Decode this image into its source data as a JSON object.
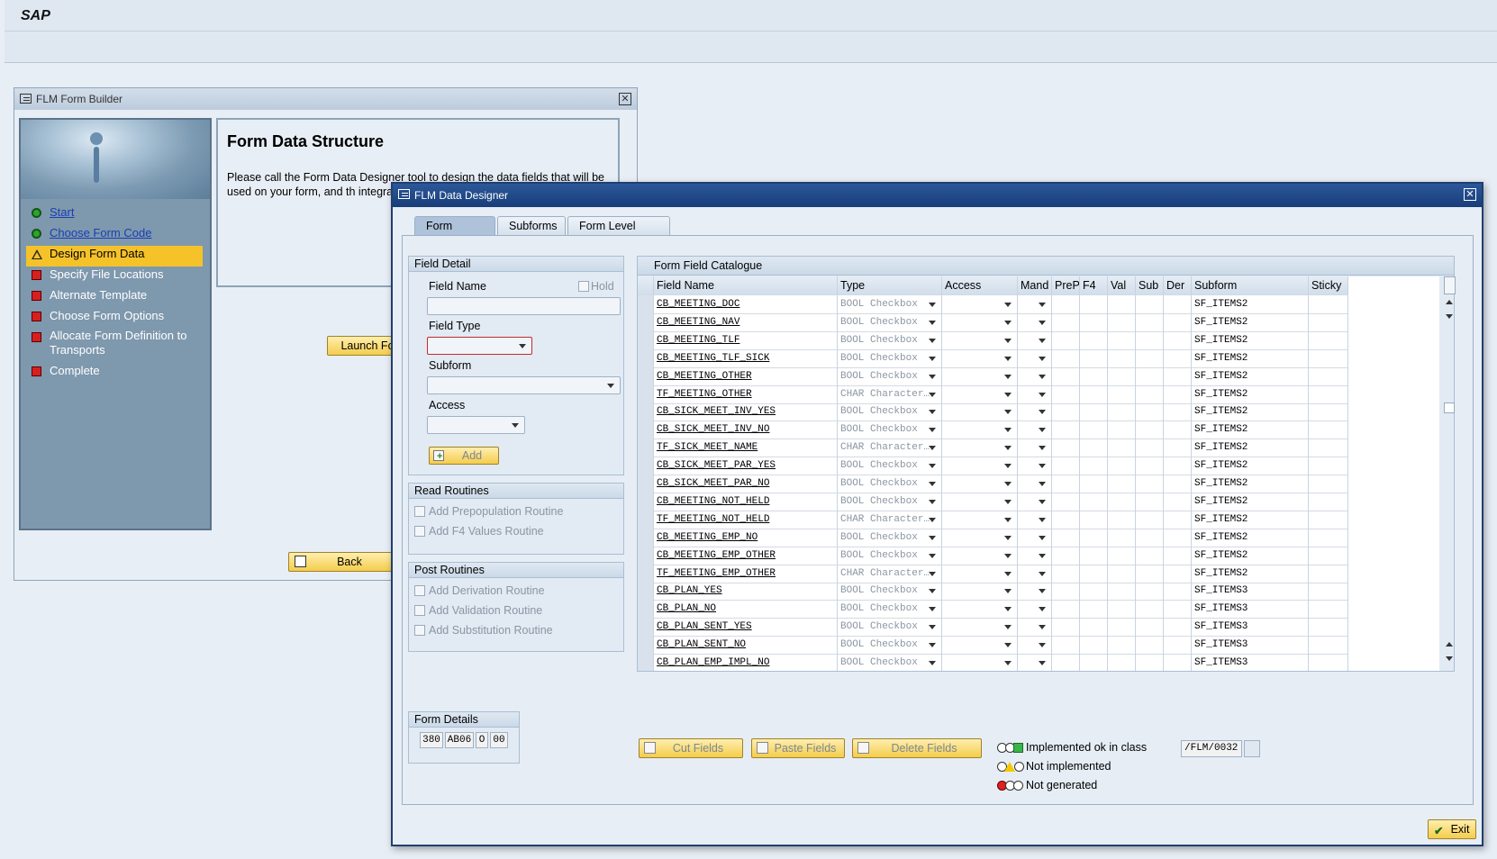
{
  "app": {
    "brand": "SAP"
  },
  "builder": {
    "title": "FLM Form Builder",
    "steps": [
      {
        "label": "Start",
        "status": "green",
        "link": true
      },
      {
        "label": "Choose Form Code",
        "status": "green",
        "link": true
      },
      {
        "label": "Design Form Data",
        "status": "warning",
        "active": true
      },
      {
        "label": "Specify File Locations",
        "status": "red"
      },
      {
        "label": "Alternate Template",
        "status": "red"
      },
      {
        "label": "Choose Form Options",
        "status": "red"
      },
      {
        "label": "Allocate Form Definition to Transports",
        "status": "red"
      },
      {
        "label": "Complete",
        "status": "red"
      }
    ],
    "content": {
      "heading": "Form Data Structure",
      "body": "Please call the Form Data Designer tool to design the data fields that will be used on your form, and th integration process."
    },
    "launch_label": "Launch Fo",
    "back_label": "Back"
  },
  "designer": {
    "title": "FLM Data Designer",
    "tabs": [
      "Form Fields",
      "Subforms",
      "Form Level Exits"
    ],
    "field_detail": {
      "title": "Field Detail",
      "field_name_label": "Field Name",
      "hold_label": "Hold",
      "field_type_label": "Field Type",
      "subform_label": "Subform",
      "access_label": "Access",
      "add_label": "Add"
    },
    "read_routines": {
      "title": "Read Routines",
      "items": [
        "Add Prepopulation Routine",
        "Add F4 Values Routine"
      ]
    },
    "post_routines": {
      "title": "Post Routines",
      "items": [
        "Add Derivation Routine",
        "Add Validation Routine",
        "Add Substitution Routine"
      ]
    },
    "form_details": {
      "title": "Form Details",
      "values": [
        "380",
        "AB06",
        "O",
        "00"
      ]
    },
    "catalogue": {
      "title": "Form Field Catalogue",
      "columns": [
        "Field Name",
        "Type",
        "Access",
        "Mand",
        "PreP",
        "F4",
        "Val",
        "Sub",
        "Der",
        "Subform",
        "Sticky"
      ],
      "rows": [
        [
          "CB_MEETING_DOC",
          "BOOL Checkbox",
          "SF_ITEMS2"
        ],
        [
          "CB_MEETING_NAV",
          "BOOL Checkbox",
          "SF_ITEMS2"
        ],
        [
          "CB_MEETING_TLF",
          "BOOL Checkbox",
          "SF_ITEMS2"
        ],
        [
          "CB_MEETING_TLF_SICK",
          "BOOL Checkbox",
          "SF_ITEMS2"
        ],
        [
          "CB_MEETING_OTHER",
          "BOOL Checkbox",
          "SF_ITEMS2"
        ],
        [
          "TF_MEETING_OTHER",
          "CHAR Character…",
          "SF_ITEMS2"
        ],
        [
          "CB_SICK_MEET_INV_YES",
          "BOOL Checkbox",
          "SF_ITEMS2"
        ],
        [
          "CB_SICK_MEET_INV_NO",
          "BOOL Checkbox",
          "SF_ITEMS2"
        ],
        [
          "TF_SICK_MEET_NAME",
          "CHAR Character…",
          "SF_ITEMS2"
        ],
        [
          "CB_SICK_MEET_PAR_YES",
          "BOOL Checkbox",
          "SF_ITEMS2"
        ],
        [
          "CB_SICK_MEET_PAR_NO",
          "BOOL Checkbox",
          "SF_ITEMS2"
        ],
        [
          "CB_MEETING_NOT_HELD",
          "BOOL Checkbox",
          "SF_ITEMS2"
        ],
        [
          "TF_MEETING_NOT_HELD",
          "CHAR Character…",
          "SF_ITEMS2"
        ],
        [
          "CB_MEETING_EMP_NO",
          "BOOL Checkbox",
          "SF_ITEMS2"
        ],
        [
          "CB_MEETING_EMP_OTHER",
          "BOOL Checkbox",
          "SF_ITEMS2"
        ],
        [
          "TF_MEETING_EMP_OTHER",
          "CHAR Character…",
          "SF_ITEMS2"
        ],
        [
          "CB_PLAN_YES",
          "BOOL Checkbox",
          "SF_ITEMS3"
        ],
        [
          "CB_PLAN_NO",
          "BOOL Checkbox",
          "SF_ITEMS3"
        ],
        [
          "CB_PLAN_SENT_YES",
          "BOOL Checkbox",
          "SF_ITEMS3"
        ],
        [
          "CB_PLAN_SENT_NO",
          "BOOL Checkbox",
          "SF_ITEMS3"
        ],
        [
          "CB_PLAN_EMP_IMPL_NO",
          "BOOL Checkbox",
          "SF_ITEMS3"
        ]
      ]
    },
    "buttons": {
      "cut": "Cut Fields",
      "paste": "Paste Fields",
      "delete": "Delete Fields",
      "exit": "Exit"
    },
    "legend": [
      "Implemented ok in class",
      "Not implemented",
      "Not generated"
    ],
    "class_field": "/FLM/0032"
  }
}
